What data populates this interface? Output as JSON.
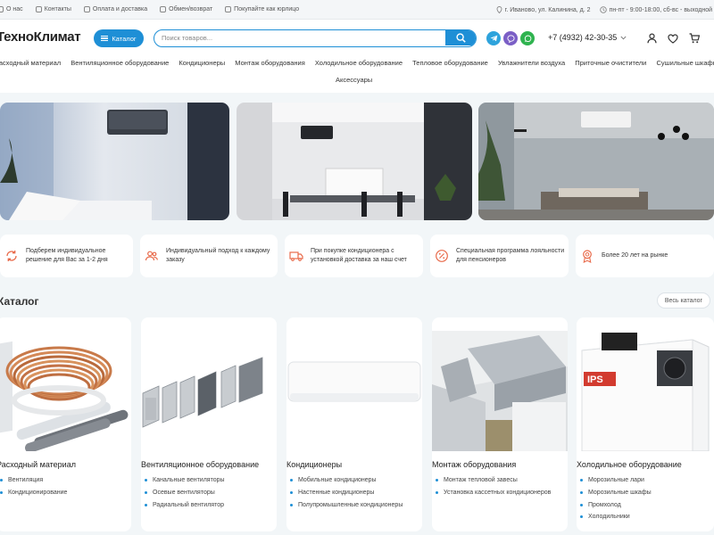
{
  "topbar": {
    "left": [
      "О нас",
      "Контакты",
      "Оплата и доставка",
      "Обмен/возврат",
      "Покупайте как юрлицо"
    ],
    "address": "г. Иваново, ул. Калинина, д. 2",
    "hours": "пн-пт - 9:00-18:00, сб-вс - выходной"
  },
  "header": {
    "logo": "ТехноКлимат",
    "catalog_label": "Каталог",
    "search_placeholder": "Поиск товаров...",
    "phone": "+7 (4932) 42-30-35",
    "accent": "#1e8fd6"
  },
  "nav": {
    "row1": [
      "Расходный материал",
      "Вентиляционное оборудование",
      "Кондиционеры",
      "Монтаж оборудования",
      "Холодильное оборудование",
      "Тепловое оборудование",
      "Увлажнители воздуха",
      "Приточные очистители",
      "Сушильные шкафы"
    ],
    "row2": "Аксессуары"
  },
  "features": [
    {
      "text": "Подберем индивидуальное решение для Вас за 1-2 дня",
      "icon": "refresh-icon"
    },
    {
      "text": "Индивидуальный подход к каждому заказу",
      "icon": "people-icon"
    },
    {
      "text": "При покупке кондиционера с установкой доставка за наш счет",
      "icon": "truck-icon"
    },
    {
      "text": "Специальная программа лояльности для пенсионеров",
      "icon": "percent-icon"
    },
    {
      "text": "Более 20 лет на рынке",
      "icon": "medal-icon"
    }
  ],
  "catalog": {
    "title": "Каталог",
    "all_label": "Весь каталог",
    "cards": [
      {
        "title": "Расходный материал",
        "items": [
          "Вентиляция",
          "Кондиционирование"
        ]
      },
      {
        "title": "Вентиляционное оборудование",
        "items": [
          "Канальные вентиляторы",
          "Осевые вентиляторы",
          "Радиальный вентилятор"
        ]
      },
      {
        "title": "Кондиционеры",
        "items": [
          "Мобильные кондиционеры",
          "Настенные кондиционеры",
          "Полупромышленные кондиционеры"
        ]
      },
      {
        "title": "Монтаж оборудования",
        "items": [
          "Монтаж тепловой завесы",
          "Установка кассетных кондиционеров"
        ]
      },
      {
        "title": "Холодильное оборудование",
        "items": [
          "Морозильные лари",
          "Морозильные шкафы",
          "Промхолод",
          "Холодильники"
        ]
      }
    ]
  }
}
